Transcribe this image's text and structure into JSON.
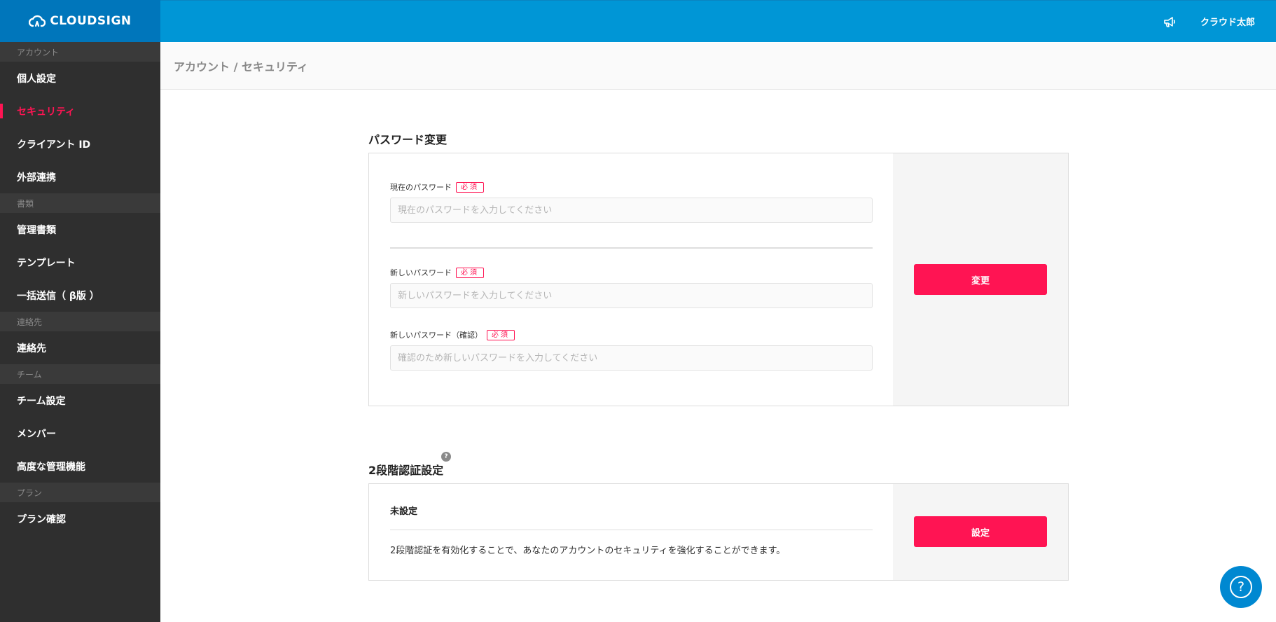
{
  "app": {
    "logo_text": "CLOUDSIGN",
    "user_name": "クラウド太郎",
    "accent_color": "#ff1453",
    "brand_color": "#0096d6"
  },
  "breadcrumb": "アカウント / セキュリティ",
  "sidebar": {
    "sections": [
      {
        "header": "アカウント",
        "items": [
          {
            "label": "個人設定",
            "active": false
          },
          {
            "label": "セキュリティ",
            "active": true
          },
          {
            "label": "クライアント ID",
            "active": false
          },
          {
            "label": "外部連携",
            "active": false
          }
        ]
      },
      {
        "header": "書類",
        "items": [
          {
            "label": "管理書類",
            "active": false
          },
          {
            "label": "テンプレート",
            "active": false
          },
          {
            "label": "一括送信（ β版 ）",
            "active": false
          }
        ]
      },
      {
        "header": "連絡先",
        "items": [
          {
            "label": "連絡先",
            "active": false
          }
        ]
      },
      {
        "header": "チーム",
        "items": [
          {
            "label": "チーム設定",
            "active": false
          },
          {
            "label": "メンバー",
            "active": false
          },
          {
            "label": "高度な管理機能",
            "active": false
          }
        ]
      },
      {
        "header": "プラン",
        "items": [
          {
            "label": "プラン確認",
            "active": false
          }
        ]
      }
    ]
  },
  "password_change": {
    "title": "パスワード変更",
    "required_badge": "必須",
    "current_label": "現在のパスワード",
    "current_placeholder": "現在のパスワードを入力してください",
    "new_label": "新しいパスワード",
    "new_placeholder": "新しいパスワードを入力してください",
    "confirm_label": "新しいパスワード（確認）",
    "confirm_placeholder": "確認のため新しいパスワードを入力してください",
    "submit_label": "変更"
  },
  "two_factor": {
    "title": "2段階認証設定",
    "help_glyph": "?",
    "status": "未設定",
    "description": "2段階認証を有効化することで、あなたのアカウントのセキュリティを強化することができます。",
    "button_label": "設定"
  },
  "help_fab_glyph": "?"
}
